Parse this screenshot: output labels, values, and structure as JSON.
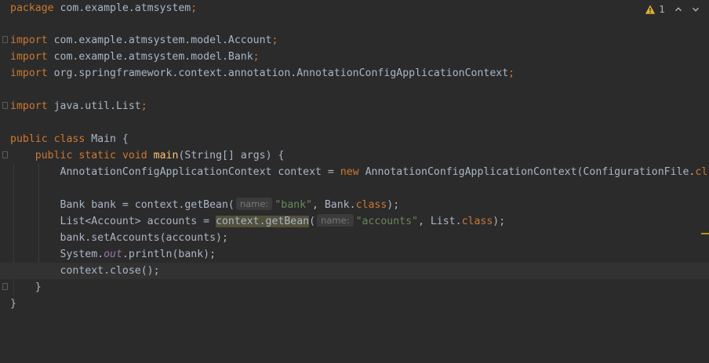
{
  "editor": {
    "lines": {
      "l1": {
        "kw": "package",
        "rest": " com.example.atmsystem",
        "semi": ";"
      },
      "l3": {
        "kw": "import",
        "rest": " com.example.atmsystem.model.Account",
        "semi": ";"
      },
      "l4": {
        "kw": "import",
        "rest": " com.example.atmsystem.model.Bank",
        "semi": ";"
      },
      "l5": {
        "kw": "import",
        "rest": " org.springframework.context.annotation.AnnotationConfigApplicationContext",
        "semi": ";"
      },
      "l7": {
        "kw": "import",
        "rest": " java.util.List",
        "semi": ";"
      },
      "l9": {
        "kw1": "public",
        "kw2": "class",
        "rest": " Main {"
      },
      "l10": {
        "indent": "    ",
        "kw1": "public",
        "kw2": "static",
        "kw3": "void",
        "fn": "main",
        "rest": "(String[] args) {"
      },
      "l11": {
        "indent": "        ",
        "p1": "AnnotationConfigApplicationContext context = ",
        "kw": "new",
        "p2": " AnnotationConfigApplicationContext(ConfigurationFile.",
        "kw_tail": "cl"
      },
      "l13": {
        "indent": "        ",
        "p1": "Bank bank = context.getBean(",
        "hint": "name:",
        "str": "\"bank\"",
        "p2": ", Bank.",
        "kw": "class",
        "p3": ");"
      },
      "l14": {
        "indent": "        ",
        "p1": "List<Account> accounts = ",
        "hl": "context.getBean",
        "p2": "(",
        "hint": "name:",
        "str": "\"accounts\"",
        "p3": ", List.",
        "kw": "class",
        "p4": ");"
      },
      "l15": {
        "indent": "        ",
        "p1": "bank.setAccounts(accounts);"
      },
      "l16": {
        "indent": "        ",
        "p1": "System.",
        "field": "out",
        "p2": ".println(bank);"
      },
      "l17": {
        "indent": "        ",
        "p1": "context.close();"
      },
      "l18": {
        "indent": "    ",
        "p1": "}"
      },
      "l19": {
        "p1": "}"
      }
    }
  },
  "status": {
    "warning_count": "1",
    "warning_icon": "warning-triangle-icon",
    "prev_icon": "chevron-up-icon",
    "next_icon": "chevron-down-icon",
    "warning_color": "#e2b02f"
  }
}
